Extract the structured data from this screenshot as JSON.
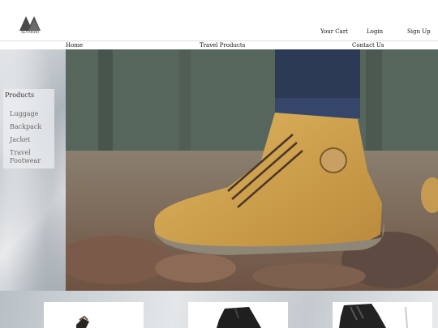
{
  "brand": {
    "name": "SDTravel"
  },
  "header_links": {
    "cart": "Your Cart",
    "login": "Login",
    "signup": "Sign Up"
  },
  "nav": {
    "home": "Home",
    "travel_products": "Travel Products",
    "contact": "Contact Us"
  },
  "sidebar": {
    "title": "Products",
    "items": [
      {
        "label": "Luggage"
      },
      {
        "label": "Backpack"
      },
      {
        "label": "Jacket"
      },
      {
        "label": "Travel Footwear"
      }
    ]
  },
  "hero": {
    "icon": "hiking-boot-photo"
  },
  "product_cards": [
    {
      "icon": "shoe-photo"
    },
    {
      "icon": "boot-photo"
    },
    {
      "icon": "boot-photo"
    }
  ]
}
